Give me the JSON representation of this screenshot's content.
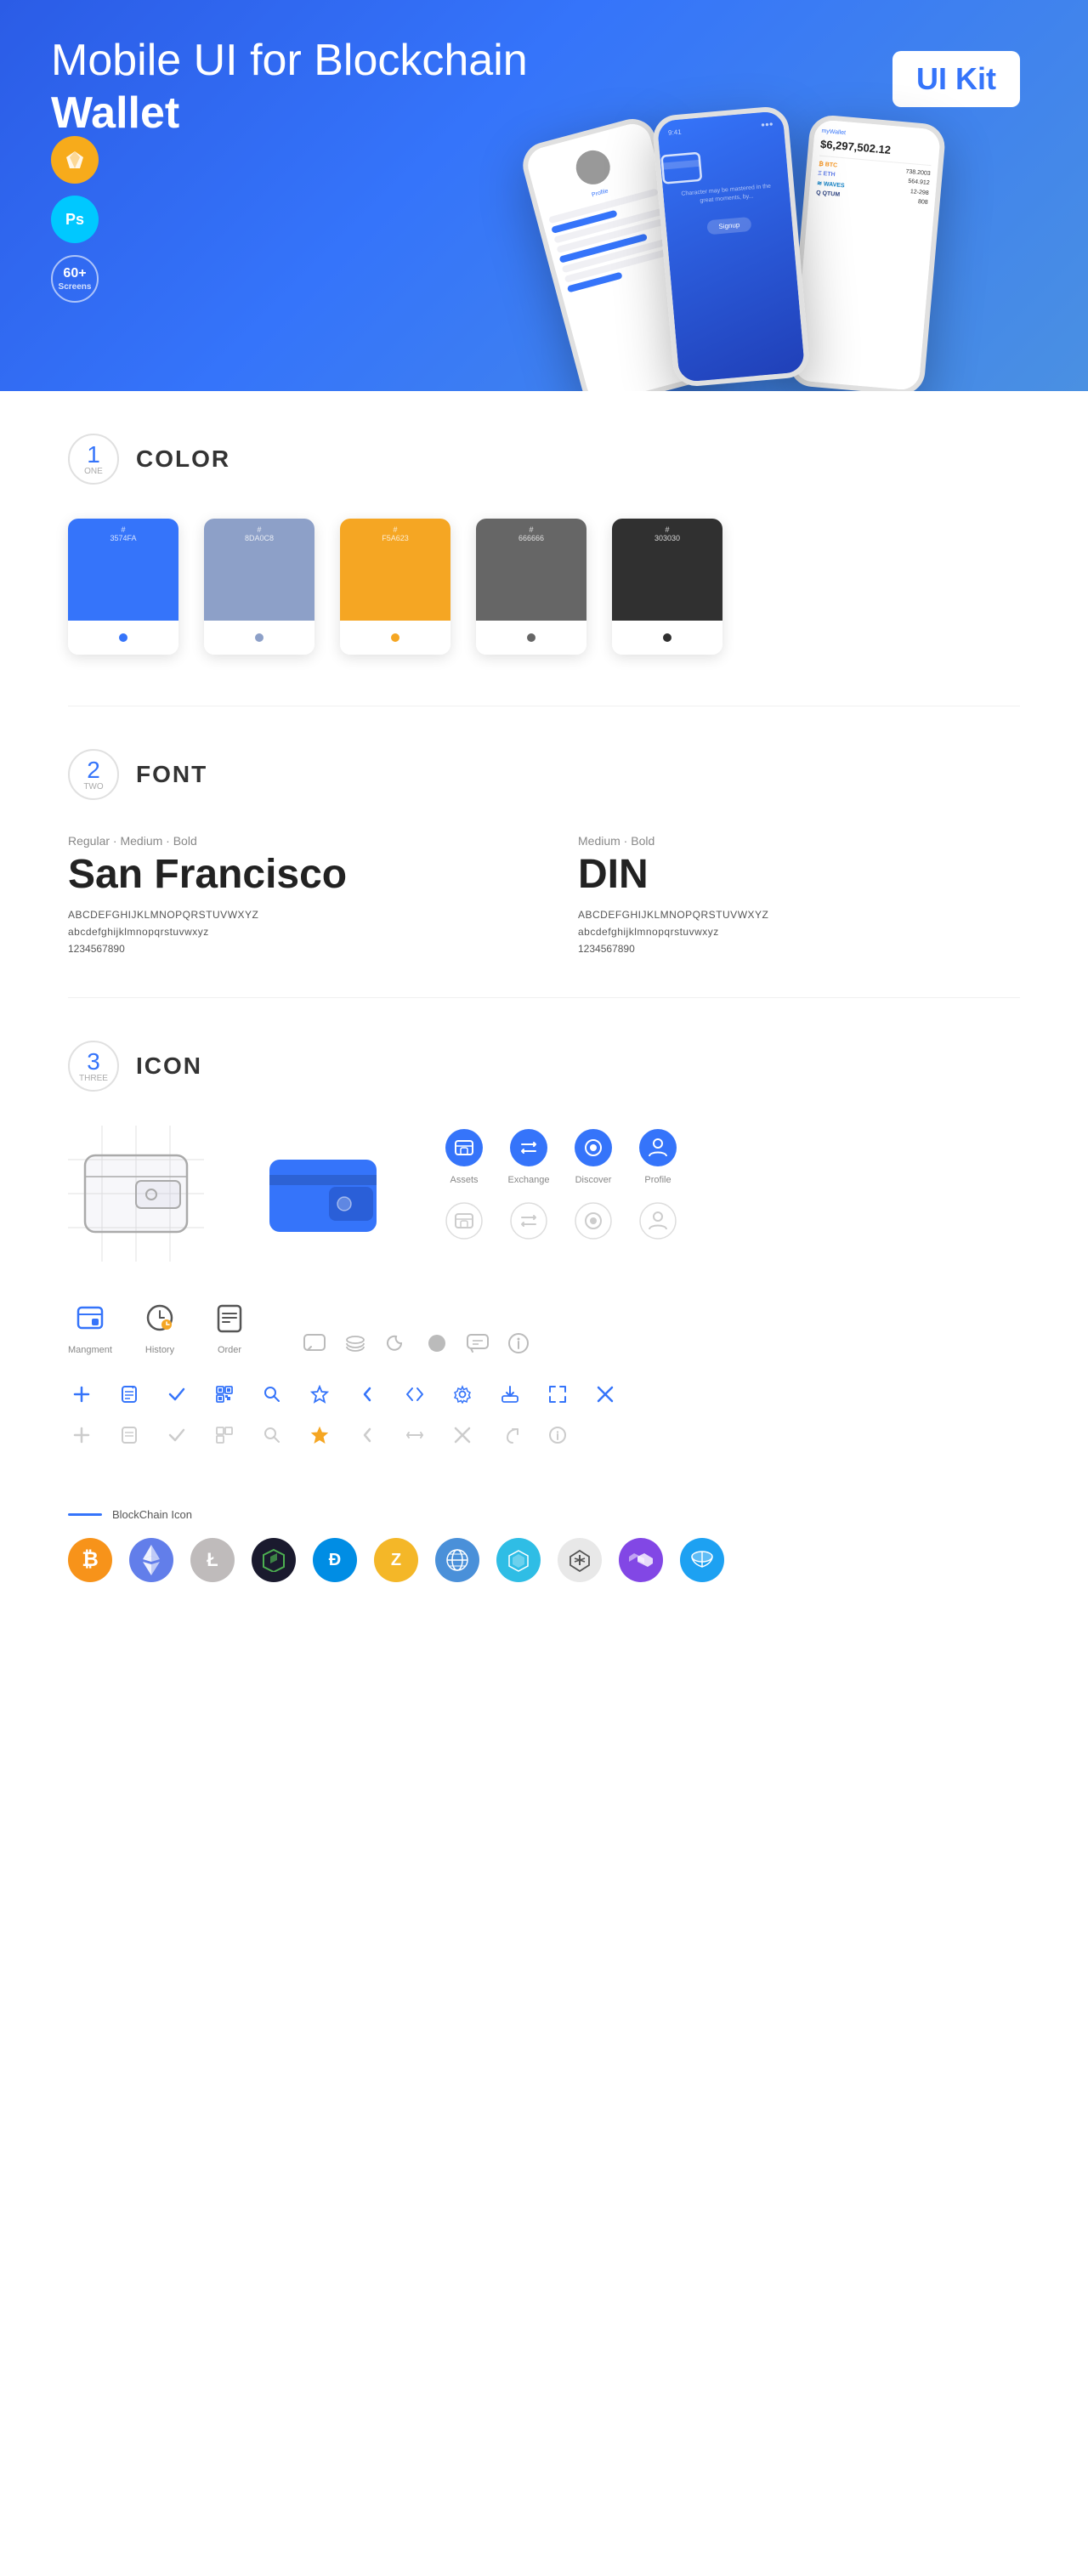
{
  "hero": {
    "title": "Mobile UI for Blockchain ",
    "title_bold": "Wallet",
    "badge": "UI Kit",
    "sketch_label": "Sketch",
    "ps_label": "Ps",
    "screens_count": "60+",
    "screens_label": "Screens"
  },
  "sections": {
    "color": {
      "number": "1",
      "number_word": "ONE",
      "title": "COLOR",
      "swatches": [
        {
          "hex": "#3574FA",
          "label": "#\n3574FA"
        },
        {
          "hex": "#8DA0C8",
          "label": "#\n8DA0C8"
        },
        {
          "hex": "#F5A623",
          "label": "#\nF5A623"
        },
        {
          "hex": "#666666",
          "label": "#\n666666"
        },
        {
          "hex": "#303030",
          "label": "#\n303030"
        }
      ]
    },
    "font": {
      "number": "2",
      "number_word": "TWO",
      "title": "FONT",
      "fonts": [
        {
          "style": "Regular · Medium · Bold",
          "name": "San Francisco",
          "uppercase": "ABCDEFGHIJKLMNOPQRSTUVWXYZ",
          "lowercase": "abcdefghijklmnopqrstuvwxyz",
          "numbers": "1234567890"
        },
        {
          "style": "Medium · Bold",
          "name": "DIN",
          "uppercase": "ABCDEFGHIJKLMNOPQRSTUVWXYZ",
          "lowercase": "abcdefghijklmnopqrstuvwxyz",
          "numbers": "1234567890"
        }
      ]
    },
    "icon": {
      "number": "3",
      "number_word": "THREE",
      "title": "ICON",
      "nav_icons": [
        {
          "label": "Assets"
        },
        {
          "label": "Exchange"
        },
        {
          "label": "Discover"
        },
        {
          "label": "Profile"
        }
      ],
      "bottom_icons": [
        {
          "label": "Mangment"
        },
        {
          "label": "History"
        },
        {
          "label": "Order"
        }
      ],
      "blockchain_label": "BlockChain Icon"
    }
  }
}
